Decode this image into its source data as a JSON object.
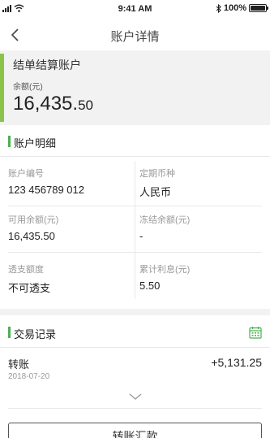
{
  "status_bar": {
    "time": "9:41 AM",
    "battery": "100%",
    "battery_level": 1.0
  },
  "nav": {
    "title": "账户详情"
  },
  "summary": {
    "account_name": "结单结算账户",
    "balance_label": "余额(元)",
    "balance_int": "16,435.",
    "balance_dec": "50"
  },
  "details": {
    "section_title": "账户明细",
    "fields": [
      {
        "label": "账户编号",
        "value": "123 456789 012"
      },
      {
        "label": "定期币种",
        "value": "人民币"
      },
      {
        "label": "可用余额(元)",
        "value": "16,435.50"
      },
      {
        "label": "冻结余额(元)",
        "value": "-"
      },
      {
        "label": "透支额度",
        "value": "不可透支"
      },
      {
        "label": "累计利息(元)",
        "value": "5.50"
      }
    ]
  },
  "transactions": {
    "section_title": "交易记录",
    "items": [
      {
        "type": "转账",
        "date": "2018-07-20",
        "amount": "+5,131.25"
      }
    ]
  },
  "bottom_button": {
    "label": "转账汇款"
  },
  "colors": {
    "accent": "#4caf50",
    "summary_bar": "#8bc34a",
    "background": "#f2f2f2"
  }
}
